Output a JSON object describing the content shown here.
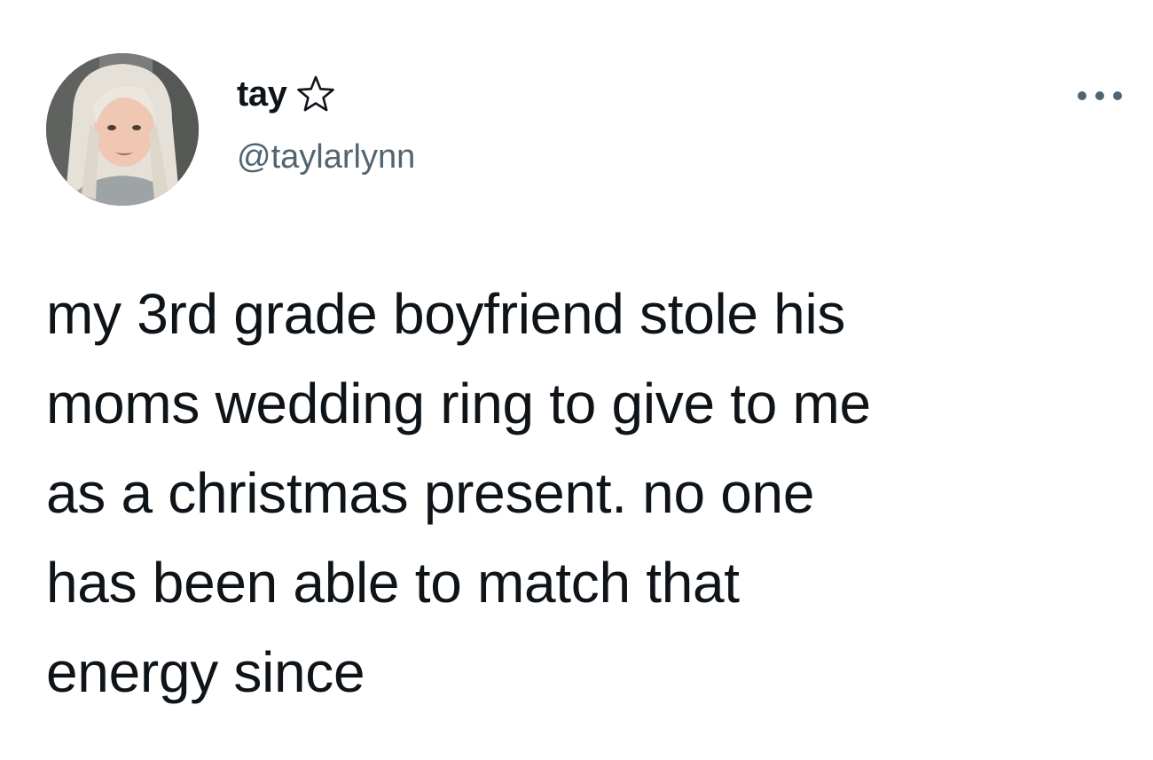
{
  "author": {
    "display_name": "tay",
    "badge_icon": "star-outline-icon",
    "handle": "@taylarlynn",
    "avatar_icon": "profile-photo"
  },
  "menu": {
    "more_icon": "more-horizontal-icon"
  },
  "tweet": {
    "text": "my 3rd grade boyfriend stole his\nmoms wedding ring to give to me\nas a christmas present. no one\nhas been able to match that\nenergy since"
  },
  "colors": {
    "text_primary": "#0f1419",
    "text_secondary": "#536471",
    "background": "#ffffff"
  }
}
